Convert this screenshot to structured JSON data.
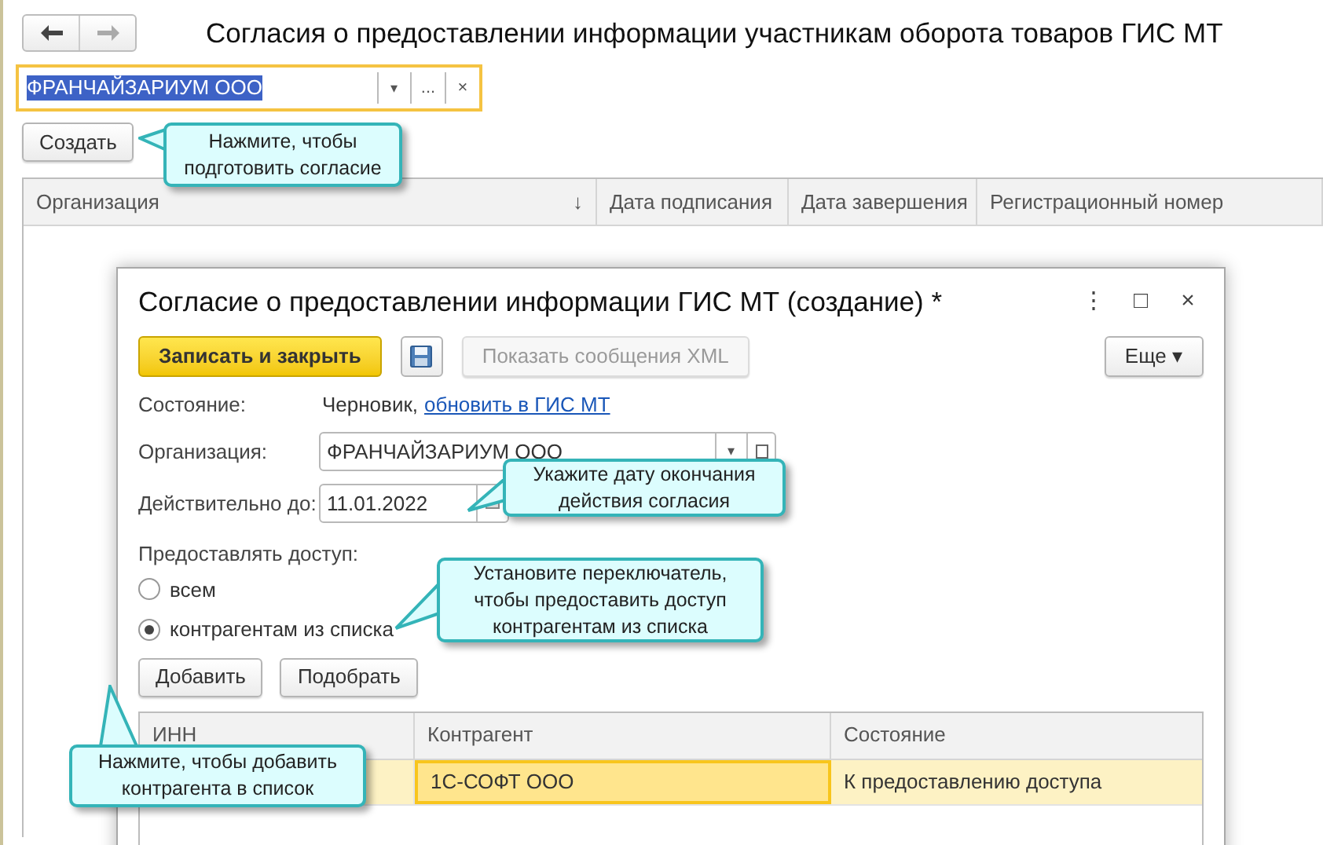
{
  "page": {
    "title": "Согласия о предоставлении информации участникам оборота товаров ГИС МТ",
    "organization_field": {
      "value": "ФРАНЧАЙЗАРИУМ ООО",
      "focused": true,
      "dropdown": "▾",
      "choose": "...",
      "clear": "×"
    },
    "create_button": "Создать",
    "table": {
      "columns": [
        {
          "label": "Организация",
          "sort": "↓"
        },
        {
          "label": "Дата подписания"
        },
        {
          "label": "Дата завершения"
        },
        {
          "label": "Регистрационный номер"
        }
      ]
    }
  },
  "dialog": {
    "title": "Согласие о предоставлении информации ГИС МТ (создание) *",
    "window_buttons": [
      "⋮",
      "□",
      "×"
    ],
    "toolbar": [
      {
        "kind": "primary",
        "label": "Записать и закрыть",
        "disabled": false
      },
      {
        "kind": "save",
        "disabled": false
      },
      {
        "kind": "plain",
        "label": "Показать сообщения XML",
        "disabled": true
      },
      {
        "kind": "more",
        "label": "Еще",
        "caret": "▾",
        "disabled": false
      }
    ],
    "state": {
      "label": "Состояние:",
      "value": "Черновик,",
      "link": "обновить в ГИС МТ"
    },
    "organization": {
      "label": "Организация:",
      "value": "ФРАНЧАЙЗАРИУМ ООО",
      "dropdown": "▾"
    },
    "valid_until": {
      "label": "Действительно до:",
      "value": "11.01.2022"
    },
    "access": {
      "label": "Предоставлять доступ:",
      "options": [
        {
          "label": "всем",
          "selected": false
        },
        {
          "label": "контрагентам из списка",
          "selected": true
        }
      ]
    },
    "list_buttons": [
      "Добавить",
      "Подобрать"
    ],
    "table": {
      "columns": [
        "ИНН",
        "Контрагент",
        "Состояние"
      ],
      "rows": [
        {
          "selected": true,
          "contractor": "1С-СОФТ ООО",
          "contractor_focused": true,
          "status": "К предоставлению доступа"
        }
      ]
    }
  },
  "callouts": [
    {
      "text": "Нажмите, чтобы подготовить согласие"
    },
    {
      "text": "Укажите дату окончания действия согласия"
    },
    {
      "text": "Установите переключатель, чтобы предоставить доступ контрагентам из списка"
    },
    {
      "text": "Нажмите, чтобы добавить контрагента в список"
    }
  ]
}
